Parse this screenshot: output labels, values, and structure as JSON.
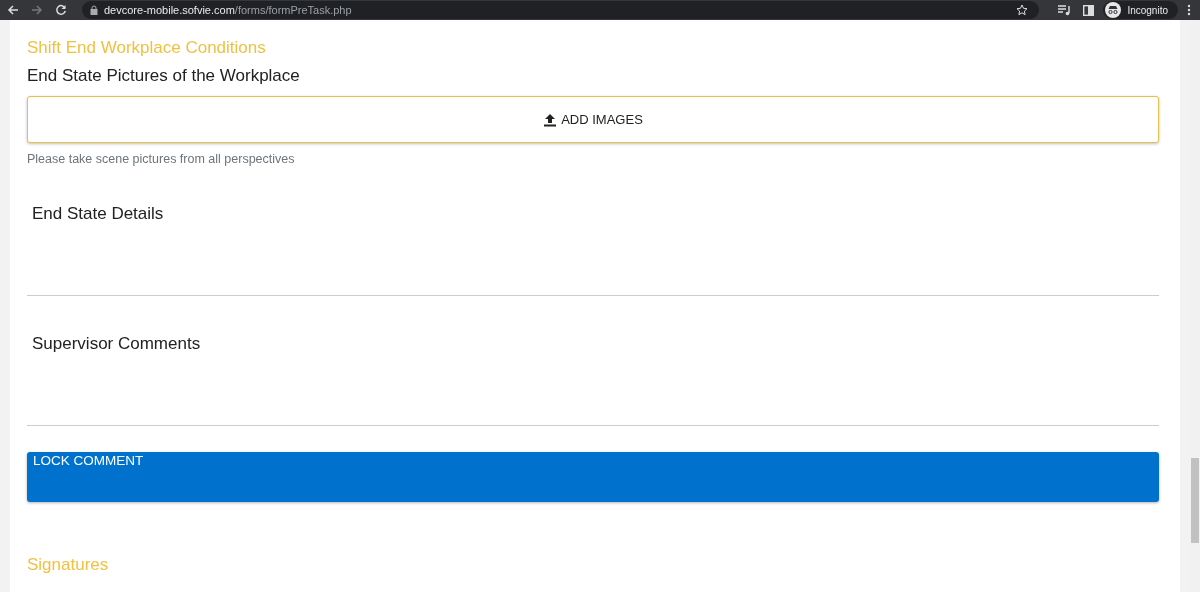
{
  "browser": {
    "url_host": "devcore-mobile.sofvie.com",
    "url_path": "/forms/formPreTask.php",
    "profile": "Incognito"
  },
  "sections": [
    {
      "kind": "form",
      "title": "Shift End Workplace Conditions",
      "upload": {
        "label": "End State Pictures of the Workplace",
        "button": "ADD IMAGES",
        "hint": "Please take scene pictures from all perspectives"
      },
      "fields": [
        {
          "label": "End State Details"
        },
        {
          "label": "Supervisor Comments"
        }
      ],
      "action": "LOCK COMMENT"
    },
    {
      "kind": "heading",
      "title": "Signatures"
    }
  ]
}
